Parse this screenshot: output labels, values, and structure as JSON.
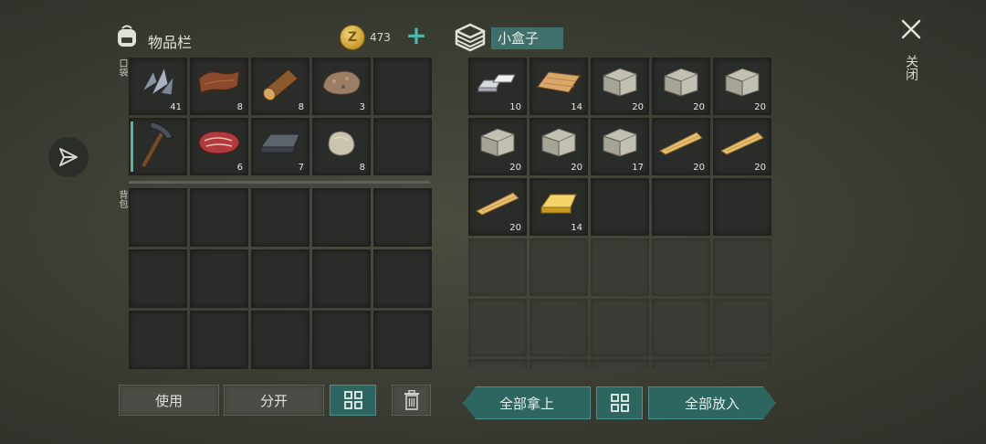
{
  "inventory": {
    "title": "物品栏",
    "coins": "473",
    "pocket_label": "口袋",
    "backpack_label": "背包",
    "pocket": [
      {
        "icon": "metal-scraps-icon",
        "count": "41"
      },
      {
        "icon": "leather-icon",
        "count": "8"
      },
      {
        "icon": "log-icon",
        "count": "8"
      },
      {
        "icon": "ore-icon",
        "count": "3"
      },
      {
        "icon": "",
        "count": ""
      },
      {
        "icon": "pickaxe-icon",
        "count": ""
      },
      {
        "icon": "raw-meat-icon",
        "count": "6"
      },
      {
        "icon": "iron-ingot-icon",
        "count": "7"
      },
      {
        "icon": "stone-icon",
        "count": "8"
      },
      {
        "icon": "",
        "count": ""
      }
    ],
    "backpack_slots": 15
  },
  "container": {
    "name": "小盒子",
    "items": [
      {
        "icon": "iron-bars-icon",
        "count": "10"
      },
      {
        "icon": "wood-plank-icon",
        "count": "14"
      },
      {
        "icon": "stone-block-icon",
        "count": "20"
      },
      {
        "icon": "stone-block-icon",
        "count": "20"
      },
      {
        "icon": "stone-block-icon",
        "count": "20"
      },
      {
        "icon": "stone-block-icon",
        "count": "20"
      },
      {
        "icon": "stone-block-icon",
        "count": "20"
      },
      {
        "icon": "stone-block-icon",
        "count": "17"
      },
      {
        "icon": "wooden-plank-icon",
        "count": "20"
      },
      {
        "icon": "wooden-plank-icon",
        "count": "20"
      },
      {
        "icon": "wooden-plank-icon",
        "count": "20"
      },
      {
        "icon": "gold-ingot-icon",
        "count": "14"
      }
    ],
    "total_slots": 30
  },
  "buttons": {
    "use": "使用",
    "split": "分开",
    "take_all": "全部拿上",
    "put_all": "全部放入",
    "close": "关闭"
  },
  "colors": {
    "accent": "#4fb7a8",
    "button_teal": "#2d6661",
    "box_name_bg": "#3e6f6a"
  }
}
